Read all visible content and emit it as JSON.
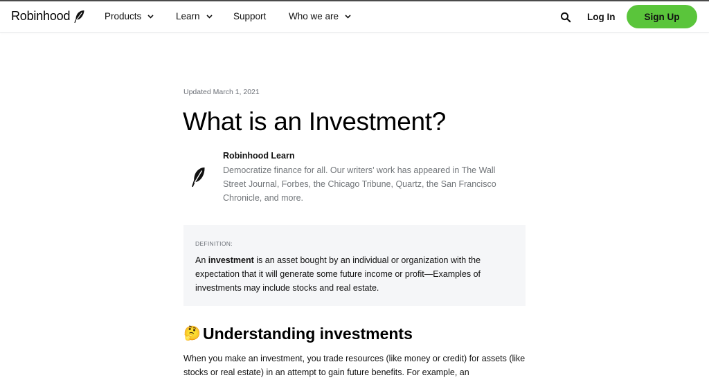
{
  "header": {
    "brand": "Robinhood",
    "brand_icon": "feather-icon",
    "nav": [
      {
        "label": "Products",
        "has_dropdown": true
      },
      {
        "label": "Learn",
        "has_dropdown": true
      },
      {
        "label": "Support",
        "has_dropdown": false
      },
      {
        "label": "Who we are",
        "has_dropdown": true
      }
    ],
    "search_icon": "search-icon",
    "login_label": "Log In",
    "signup_label": "Sign Up",
    "accent_color": "#5ac53b"
  },
  "article": {
    "updated": "Updated March 1, 2021",
    "title": "What is an Investment?",
    "author": {
      "name": "Robinhood Learn",
      "bio": "Democratize finance for all. Our writers’ work has appeared in The Wall Street Journal, Forbes, the Chicago Tribune, Quartz, the San Francisco Chronicle, and more.",
      "icon": "feather-icon"
    },
    "definition": {
      "label": "DEFINITION:",
      "prefix": "An ",
      "term": "investment",
      "text": " is an asset bought by an individual or organization with the expectation that it will generate some future income or profit—Examples of investments may include stocks and real estate."
    },
    "section": {
      "emoji": "🤔",
      "heading": "Understanding investments",
      "body": "When you make an investment, you trade resources (like money or credit) for assets (like stocks or real estate) in an attempt to gain future benefits. For example, an"
    }
  }
}
